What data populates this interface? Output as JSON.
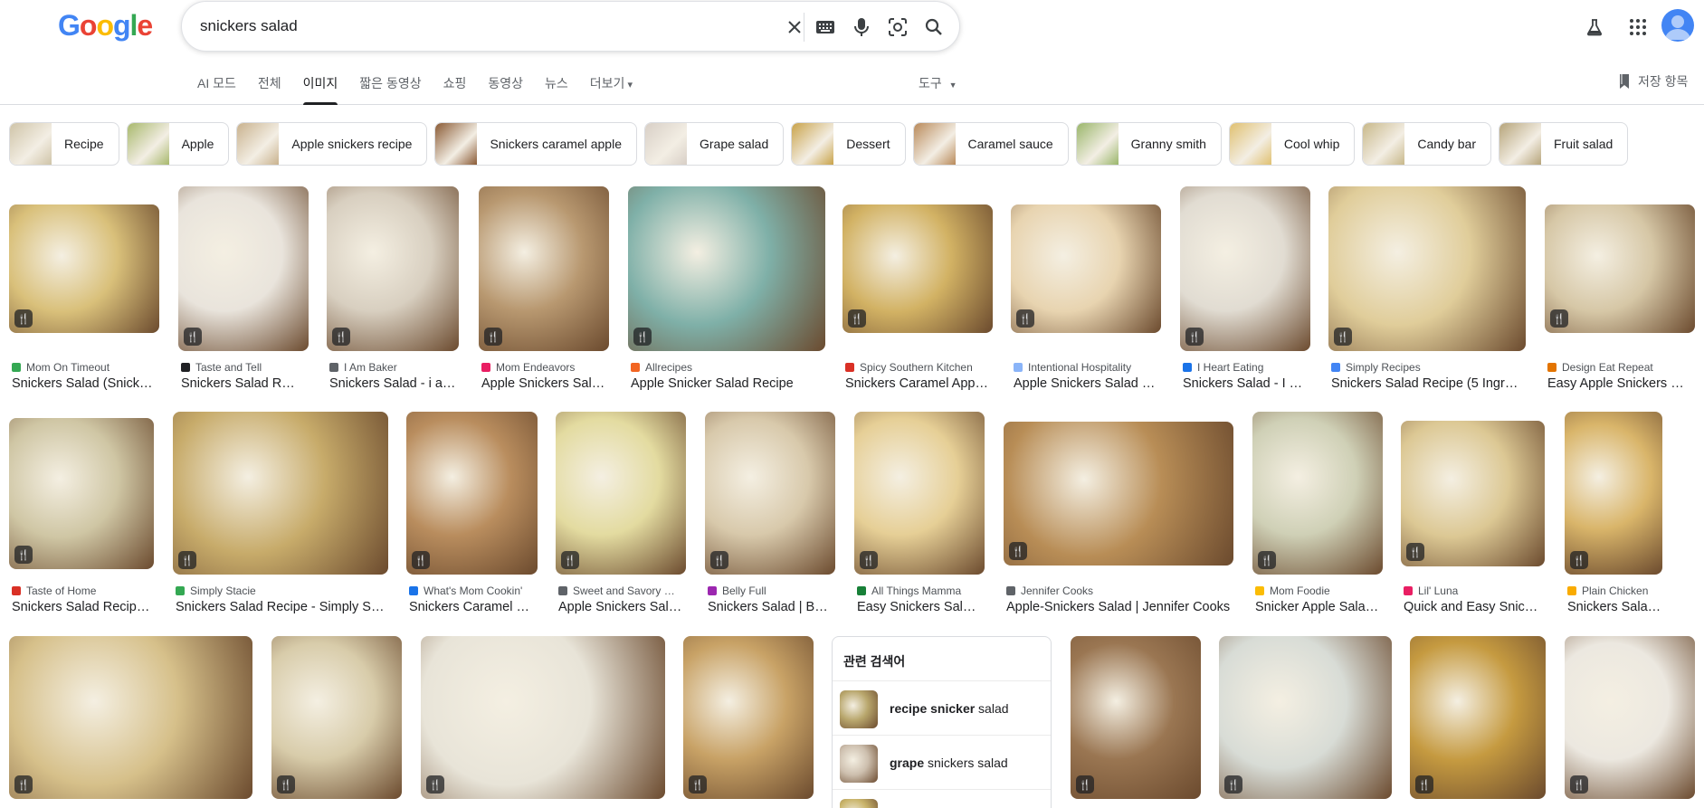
{
  "search": {
    "query": "snickers salad"
  },
  "tabs": [
    "AI 모드",
    "전체",
    "이미지",
    "짧은 동영상",
    "쇼핑",
    "동영상",
    "뉴스",
    "더보기"
  ],
  "active_tab_index": 2,
  "tools_label": "도구",
  "saved_label": "저장 항목",
  "logo": [
    "G",
    "o",
    "o",
    "g",
    "l",
    "e"
  ],
  "logo_colors": [
    "#4285f4",
    "#ea4335",
    "#fbbc05",
    "#4285f4",
    "#34a853",
    "#ea4335"
  ],
  "chips": [
    {
      "label": "Recipe",
      "color": "#cfc4a8"
    },
    {
      "label": "Apple",
      "color": "#a8b86c"
    },
    {
      "label": "Apple snickers recipe",
      "color": "#c9b28e"
    },
    {
      "label": "Snickers caramel apple",
      "color": "#8a5a34"
    },
    {
      "label": "Grape salad",
      "color": "#d8cfc6"
    },
    {
      "label": "Dessert",
      "color": "#c9a34a"
    },
    {
      "label": "Caramel sauce",
      "color": "#b98a5a"
    },
    {
      "label": "Granny smith",
      "color": "#9ab66a"
    },
    {
      "label": "Cool whip",
      "color": "#e0c070"
    },
    {
      "label": "Candy bar",
      "color": "#c8b88a"
    },
    {
      "label": "Fruit salad",
      "color": "#b6a47a"
    }
  ],
  "row1": [
    {
      "source": "Mom On Timeout",
      "title": "Snickers Salad (Snick…",
      "color": "#d9c07a",
      "dot": "#34a853"
    },
    {
      "source": "Taste and Tell",
      "title": "Snickers Salad Re…",
      "color": "#e9e4dc",
      "dot": "#202124"
    },
    {
      "source": "I Am Baker",
      "title": "Snickers Salad - i a…",
      "color": "#d8cfc0",
      "dot": "#5f6368"
    },
    {
      "source": "Mom Endeavors",
      "title": "Apple Snickers Sal…",
      "color": "#b89870",
      "dot": "#e91e63"
    },
    {
      "source": "Allrecipes",
      "title": "Apple Snicker Salad Recipe",
      "color": "#7fb0a8",
      "dot": "#f26522"
    },
    {
      "source": "Spicy Southern Kitchen",
      "title": "Snickers Caramel App…",
      "color": "#d2b264",
      "dot": "#d93025"
    },
    {
      "source": "Intentional Hospitality",
      "title": "Apple Snickers Salad …",
      "color": "#e8d4b0",
      "dot": "#8ab4f8"
    },
    {
      "source": "I Heart Eating",
      "title": "Snickers Salad - I …",
      "color": "#e1dcd2",
      "dot": "#1a73e8"
    },
    {
      "source": "Simply Recipes",
      "title": "Snickers Salad Recipe (5 Ingr…",
      "color": "#e0cd9a",
      "dot": "#4285f4"
    },
    {
      "source": "Design Eat Repeat",
      "title": "Easy Apple Snickers …",
      "color": "#d6c7a6",
      "dot": "#e37400"
    }
  ],
  "row2": [
    {
      "source": "Taste of Home",
      "title": "Snickers Salad Recip…",
      "color": "#cfc6a4",
      "dot": "#d93025"
    },
    {
      "source": "Simply Stacie",
      "title": "Snickers Salad Recipe - Simply S…",
      "color": "#c7ab6a",
      "dot": "#34a853"
    },
    {
      "source": "What's Mom Cookin'",
      "title": "Snickers Caramel …",
      "color": "#b98d5e",
      "dot": "#1a73e8"
    },
    {
      "source": "Sweet and Savory …",
      "title": "Apple Snickers Sal…",
      "color": "#e3dba0",
      "dot": "#5f6368"
    },
    {
      "source": "Belly Full",
      "title": "Snickers Salad | B…",
      "color": "#d8c9ab",
      "dot": "#9c27b0"
    },
    {
      "source": "All Things Mamma",
      "title": "Easy Snickers Sal…",
      "color": "#e6cf96",
      "dot": "#188038"
    },
    {
      "source": "Jennifer Cooks",
      "title": "Apple-Snickers Salad | Jennifer Cooks",
      "color": "#b88d56",
      "dot": "#5f6368"
    },
    {
      "source": "Mom Foodie",
      "title": "Snicker Apple Sala…",
      "color": "#cfd0b6",
      "dot": "#fbbc05"
    },
    {
      "source": "Lil' Luna",
      "title": "Quick and Easy Snic…",
      "color": "#dcc894",
      "dot": "#e91e63"
    },
    {
      "source": "Plain Chicken",
      "title": "Snickers Salad - Pl…",
      "color": "#d9b56a",
      "dot": "#f9ab00"
    }
  ],
  "row3": [
    {
      "color": "#d6c08a"
    },
    {
      "color": "#d8ccaa"
    },
    {
      "color": "#e8e4d8"
    },
    {
      "color": "#c8a266"
    },
    {
      "color": "#9a7652"
    },
    {
      "color": "#d8dcd6"
    },
    {
      "color": "#c59a40"
    },
    {
      "color": "#ece8e0"
    }
  ],
  "related": {
    "title": "관련 검색어",
    "items": [
      {
        "bold": "recipe snicker",
        "rest": " salad",
        "color": "#b8a66c"
      },
      {
        "bold": "grape",
        "rest": " snickers salad",
        "color": "#cdbfae"
      }
    ]
  }
}
